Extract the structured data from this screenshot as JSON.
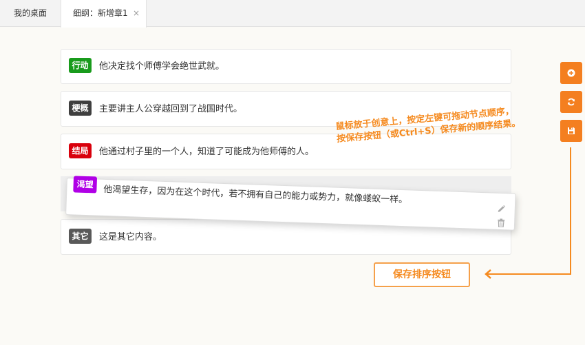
{
  "tabs": [
    {
      "label": "我的桌面"
    },
    {
      "label": "细纲：新增章1",
      "close": "×"
    }
  ],
  "cards": [
    {
      "badge": "行动",
      "badge_color": "#199b1c",
      "text": "他决定找个师傅学会绝世武就。"
    },
    {
      "badge": "梗概",
      "badge_color": "#3f3f3f",
      "text": "主要讲主人公穿越回到了战国时代。"
    },
    {
      "badge": "结局",
      "badge_color": "#d9000c",
      "text": "他通过村子里的一个人，知道了可能成为他师傅的人。"
    },
    {
      "badge": "其它",
      "badge_color": "#595959",
      "text": "这是其它内容。"
    }
  ],
  "dragging_card": {
    "badge": "渴望",
    "badge_color": "#b000e6",
    "text": "他渴望生存，因为在这个时代，若不拥有自己的能力或势力，就像蝼蚁一样。"
  },
  "side_buttons": [
    {
      "icon": "plus-circle-icon"
    },
    {
      "icon": "refresh-icon"
    },
    {
      "icon": "save-icon"
    }
  ],
  "tip": {
    "line1": "鼠标放于创意上，按定左键可拖动节点顺序，",
    "line2": "按保存按钮（或Ctrl+S）保存新的顺序结果。"
  },
  "save_sort_label": "保存排序按钮",
  "colors": {
    "accent": "#f47f20"
  }
}
